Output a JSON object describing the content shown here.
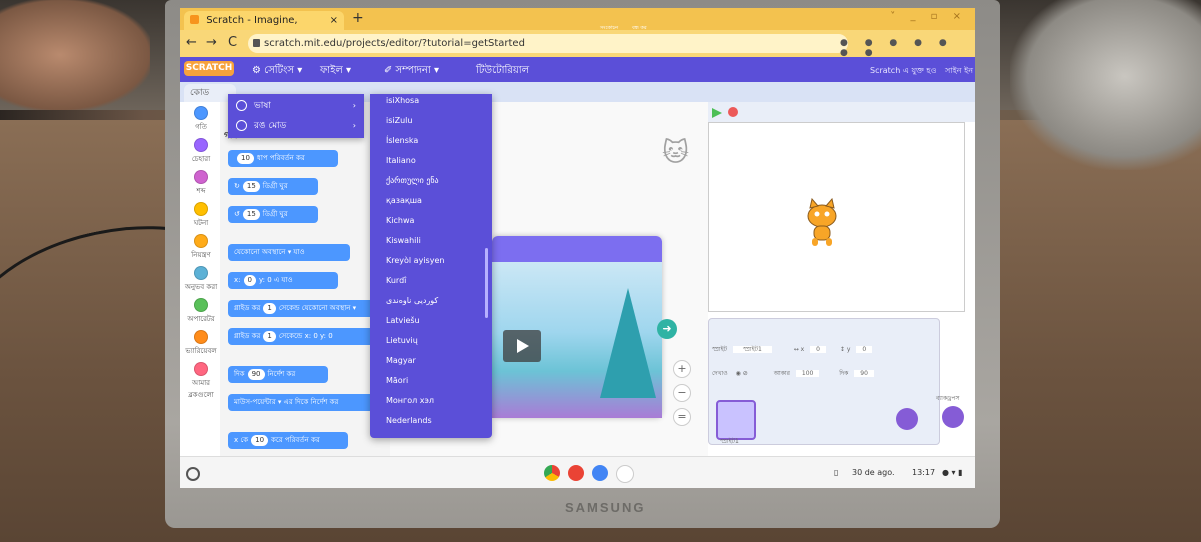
{
  "browser": {
    "tab_title": "Scratch - Imagine, Program, Sha",
    "tab_close": "×",
    "new_tab": "+",
    "url": "scratch.mit.edu/projects/editor/?tutorial=getStarted",
    "back": "←",
    "forward": "→",
    "reload": "C",
    "window_controls": "˅ _ ▫ ×"
  },
  "menubar": {
    "logo": "SCRATCH",
    "settings": "⚙ সেটিংস ▾",
    "file": "ফাইল ▾",
    "edit": "✐ সম্পাদনা ▾",
    "tutorials": "টিউটোরিয়াল",
    "right_1": "Scratch এ যুক্ত হও",
    "right_2": "সাইন ইন"
  },
  "settings_menu": {
    "language": "ভাষা",
    "color_mode": "রঙ মোড"
  },
  "languages": [
    "isiXhosa",
    "isiZulu",
    "Íslenska",
    "Italiano",
    "ქართული ენა",
    "қазақша",
    "Kichwa",
    "Kiswahili",
    "Kreyòl ayisyen",
    "Kurdî",
    "کوردیی ناوەندی",
    "Latviešu",
    "Lietuvių",
    "Magyar",
    "Māori",
    "Монгол хэл",
    "Nederlands"
  ],
  "code_tab": "কোড",
  "palette_title": "গতি",
  "categories": [
    {
      "label": "গতি",
      "color": "#4c97ff"
    },
    {
      "label": "চেহারা",
      "color": "#9966ff"
    },
    {
      "label": "শব্দ",
      "color": "#cf63cf"
    },
    {
      "label": "ঘটনা",
      "color": "#ffbf00"
    },
    {
      "label": "নিয়ন্ত্রণ",
      "color": "#ffab19"
    },
    {
      "label": "অনুভব করা",
      "color": "#5cb1d6"
    },
    {
      "label": "অপারেটর",
      "color": "#59c059"
    },
    {
      "label": "ভ্যারিয়েবল",
      "color": "#ff8c1a"
    },
    {
      "label": "আমার ব্লকগুলো",
      "color": "#ff6680"
    }
  ],
  "blocks": [
    {
      "pre": "",
      "num": "10",
      "post": "ধাপ পরিবর্তন কর"
    },
    {
      "pre": "↻",
      "num": "15",
      "post": "ডিগ্রী ঘুর"
    },
    {
      "pre": "↺",
      "num": "15",
      "post": "ডিগ্রী ঘুর"
    },
    {
      "pre": "",
      "num": "",
      "post": "যেকোনো অবস্থানে ▾ যাও"
    },
    {
      "pre": "x:",
      "num": "0",
      "post": "y: 0 এ যাও"
    },
    {
      "pre": "গ্লাইড কর",
      "num": "1",
      "post": "সেকেন্ড যেকোনো অবস্থান ▾"
    },
    {
      "pre": "গ্লাইড কর",
      "num": "1",
      "post": "সেকেন্ডে x: 0 y: 0"
    },
    {
      "pre": "দিক",
      "num": "90",
      "post": "নির্দেশ কর"
    },
    {
      "pre": "",
      "num": "",
      "post": "মাউস-পয়েন্টার ▾ এর দিকে নির্দেশ কর"
    },
    {
      "pre": "x কে",
      "num": "10",
      "post": "করে পরিবর্তন কর"
    }
  ],
  "tutorial_card": {
    "btn_collapse": "সংকোচন",
    "btn_close": "বন্ধ কর",
    "next": "➜"
  },
  "zoom": {
    "in": "+",
    "out": "−",
    "reset": "="
  },
  "sprite_info": {
    "sprite_label": "স্প্রাইট",
    "sprite_name": "স্প্রাইট1",
    "x_label": "↔ x",
    "x_val": "0",
    "y_label": "↕ y",
    "y_val": "0",
    "show_label": "দেখাও",
    "size_label": "আকার",
    "size_val": "100",
    "direction_label": "দিক",
    "direction_val": "90",
    "thumb_label": "স্প্রাইট1",
    "backdrops": "ব্যাকড্রপস"
  },
  "taskbar": {
    "date": "30 de ago.",
    "time": "13:17"
  },
  "device_brand": "SAMSUNG",
  "colors": {
    "scratch_purple": "#5b4fd8",
    "motion_blue": "#4c97ff",
    "browser_yellow": "#f3c24f"
  }
}
